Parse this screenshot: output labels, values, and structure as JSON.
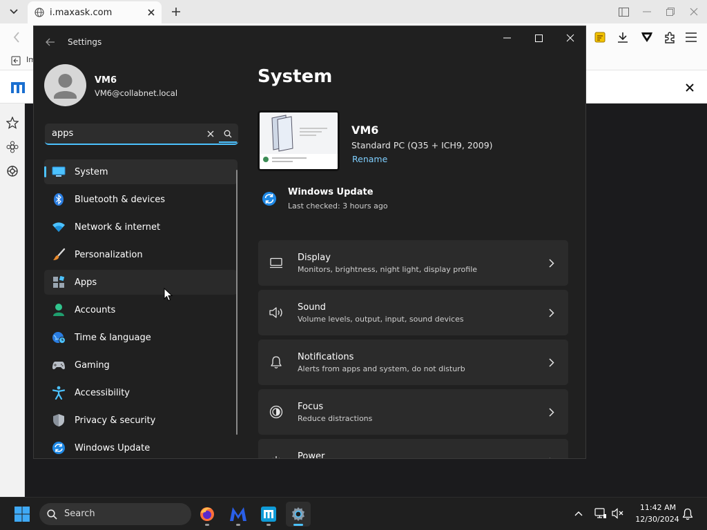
{
  "browser": {
    "tab_title": "i.maxask.com",
    "bookmark_label": "Im"
  },
  "settings": {
    "window_title": "Settings",
    "user": {
      "name": "VM6",
      "email": "VM6@collabnet.local"
    },
    "search": {
      "value": "apps"
    },
    "nav": [
      {
        "label": "System",
        "icon": "monitor-icon",
        "selected": true
      },
      {
        "label": "Bluetooth & devices",
        "icon": "bluetooth-icon"
      },
      {
        "label": "Network & internet",
        "icon": "wifi-icon"
      },
      {
        "label": "Personalization",
        "icon": "brush-icon"
      },
      {
        "label": "Apps",
        "icon": "apps-icon",
        "hover": true
      },
      {
        "label": "Accounts",
        "icon": "person-icon"
      },
      {
        "label": "Time & language",
        "icon": "globe-clock-icon"
      },
      {
        "label": "Gaming",
        "icon": "gamepad-icon"
      },
      {
        "label": "Accessibility",
        "icon": "accessibility-icon"
      },
      {
        "label": "Privacy & security",
        "icon": "shield-icon"
      },
      {
        "label": "Windows Update",
        "icon": "update-icon"
      }
    ],
    "main": {
      "title": "System",
      "device": {
        "name": "VM6",
        "model": "Standard PC (Q35 + ICH9, 2009)",
        "rename": "Rename"
      },
      "windows_update": {
        "title": "Windows Update",
        "subtitle": "Last checked: 3 hours ago"
      },
      "cards": [
        {
          "title": "Display",
          "subtitle": "Monitors, brightness, night light, display profile",
          "icon": "display-icon"
        },
        {
          "title": "Sound",
          "subtitle": "Volume levels, output, input, sound devices",
          "icon": "speaker-icon"
        },
        {
          "title": "Notifications",
          "subtitle": "Alerts from apps and system, do not disturb",
          "icon": "bell-icon"
        },
        {
          "title": "Focus",
          "subtitle": "Reduce distractions",
          "icon": "focus-icon"
        },
        {
          "title": "Power",
          "subtitle": "",
          "icon": "power-icon"
        }
      ]
    }
  },
  "taskbar": {
    "search_label": "Search",
    "time": "11:42 AM",
    "date": "12/30/2024"
  },
  "colors": {
    "accent": "#4cc2ff",
    "window_bg": "#202020",
    "card_bg": "#2b2b2b"
  }
}
